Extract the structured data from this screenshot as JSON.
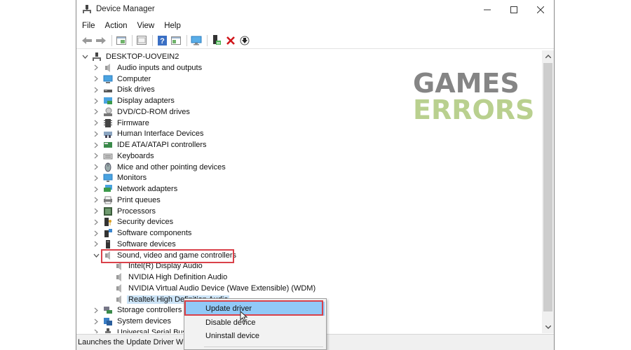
{
  "window": {
    "title": "Device Manager",
    "controls": {
      "minimize": "—",
      "maximize": "☐",
      "close": "✕"
    }
  },
  "menu": [
    {
      "label": "File"
    },
    {
      "label": "Action"
    },
    {
      "label": "View"
    },
    {
      "label": "Help"
    }
  ],
  "toolbar": [
    {
      "name": "back-icon"
    },
    {
      "name": "forward-icon"
    },
    {
      "name": "show-hide-console-tree-icon"
    },
    {
      "name": "properties-icon"
    },
    {
      "name": "help-icon"
    },
    {
      "name": "action-pane-icon"
    },
    {
      "name": "scan-hardware-changes-icon"
    },
    {
      "name": "update-driver-icon"
    },
    {
      "name": "uninstall-device-icon"
    },
    {
      "name": "disable-device-icon"
    }
  ],
  "tree": {
    "root": "DESKTOP-UOVEIN2",
    "categories": [
      {
        "label": "Audio inputs and outputs",
        "icon": "speaker-icon"
      },
      {
        "label": "Computer",
        "icon": "computer-icon"
      },
      {
        "label": "Disk drives",
        "icon": "disk-drive-icon"
      },
      {
        "label": "Display adapters",
        "icon": "display-adapter-icon"
      },
      {
        "label": "DVD/CD-ROM drives",
        "icon": "dvd-drive-icon"
      },
      {
        "label": "Firmware",
        "icon": "firmware-icon"
      },
      {
        "label": "Human Interface Devices",
        "icon": "hid-icon"
      },
      {
        "label": "IDE ATA/ATAPI controllers",
        "icon": "ide-controller-icon"
      },
      {
        "label": "Keyboards",
        "icon": "keyboard-icon"
      },
      {
        "label": "Mice and other pointing devices",
        "icon": "mouse-icon"
      },
      {
        "label": "Monitors",
        "icon": "monitor-icon"
      },
      {
        "label": "Network adapters",
        "icon": "network-adapter-icon"
      },
      {
        "label": "Print queues",
        "icon": "printer-icon"
      },
      {
        "label": "Processors",
        "icon": "processor-icon"
      },
      {
        "label": "Security devices",
        "icon": "security-device-icon"
      },
      {
        "label": "Software components",
        "icon": "software-component-icon"
      },
      {
        "label": "Software devices",
        "icon": "software-device-icon"
      },
      {
        "label": "Sound, video and game controllers",
        "icon": "speaker-icon",
        "expanded": true
      },
      {
        "label": "Storage controllers",
        "icon": "storage-controller-icon"
      },
      {
        "label": "System devices",
        "icon": "system-device-icon"
      },
      {
        "label": "Universal Serial Bus c",
        "icon": "usb-icon"
      }
    ],
    "sound_children": [
      {
        "label": "Intel(R) Display Audio"
      },
      {
        "label": "NVIDIA High Definition Audio"
      },
      {
        "label": "NVIDIA Virtual Audio Device (Wave Extensible) (WDM)"
      },
      {
        "label": "Realtek High Definition Audio",
        "selected": true
      }
    ]
  },
  "context_menu": {
    "items": [
      {
        "label": "Update driver",
        "hover": true
      },
      {
        "label": "Disable device"
      },
      {
        "label": "Uninstall device"
      }
    ]
  },
  "status": "Launches the Update Driver Wiza",
  "watermark": {
    "line1": "GAMES",
    "line2": "ERRORS"
  },
  "colors": {
    "highlight_box": "#d9414a",
    "selection": "#cce4f7",
    "menu_hover": "#91c9f7",
    "watermark_gray": "#858585",
    "watermark_green": "#b9d08f"
  }
}
